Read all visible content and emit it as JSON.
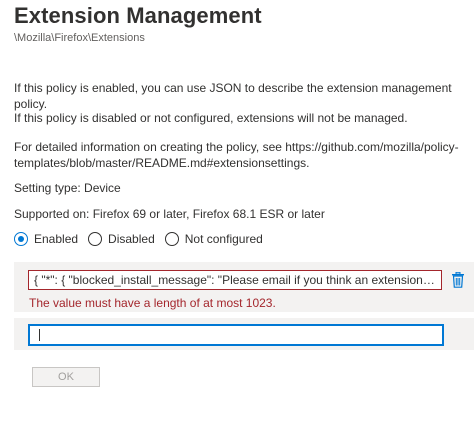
{
  "header": {
    "title": "Extension Management",
    "breadcrumb": "\\Mozilla\\Firefox\\Extensions"
  },
  "description": {
    "enabled_text": "If this policy is enabled, you can use JSON to describe the extension management policy.",
    "disabled_text": "If this policy is disabled or not configured, extensions will not be managed.",
    "info_line1": "For detailed information on creating the policy, see https://github.com/mozilla/policy-",
    "info_line2": "templates/blob/master/README.md#extensionsettings.",
    "setting_type": "Setting type: Device",
    "supported_on": "Supported on: Firefox 69 or later, Firefox 68.1 ESR or later"
  },
  "state_options": [
    {
      "label": "Enabled",
      "selected": true
    },
    {
      "label": "Disabled",
      "selected": false
    },
    {
      "label": "Not configured",
      "selected": false
    }
  ],
  "values": {
    "entry_text": "{ \"*\": { \"blocked_install_message\": \"Please email  if you think an extension shoul...",
    "error_message": "The value must have a length of at most 1023.",
    "new_entry_value": ""
  },
  "footer": {
    "ok_label": "OK",
    "ok_enabled": false
  },
  "colors": {
    "accent": "#0078d4",
    "error": "#a4262c",
    "row_background": "#f3f2f1"
  },
  "icons": {
    "delete": "trash-icon"
  }
}
